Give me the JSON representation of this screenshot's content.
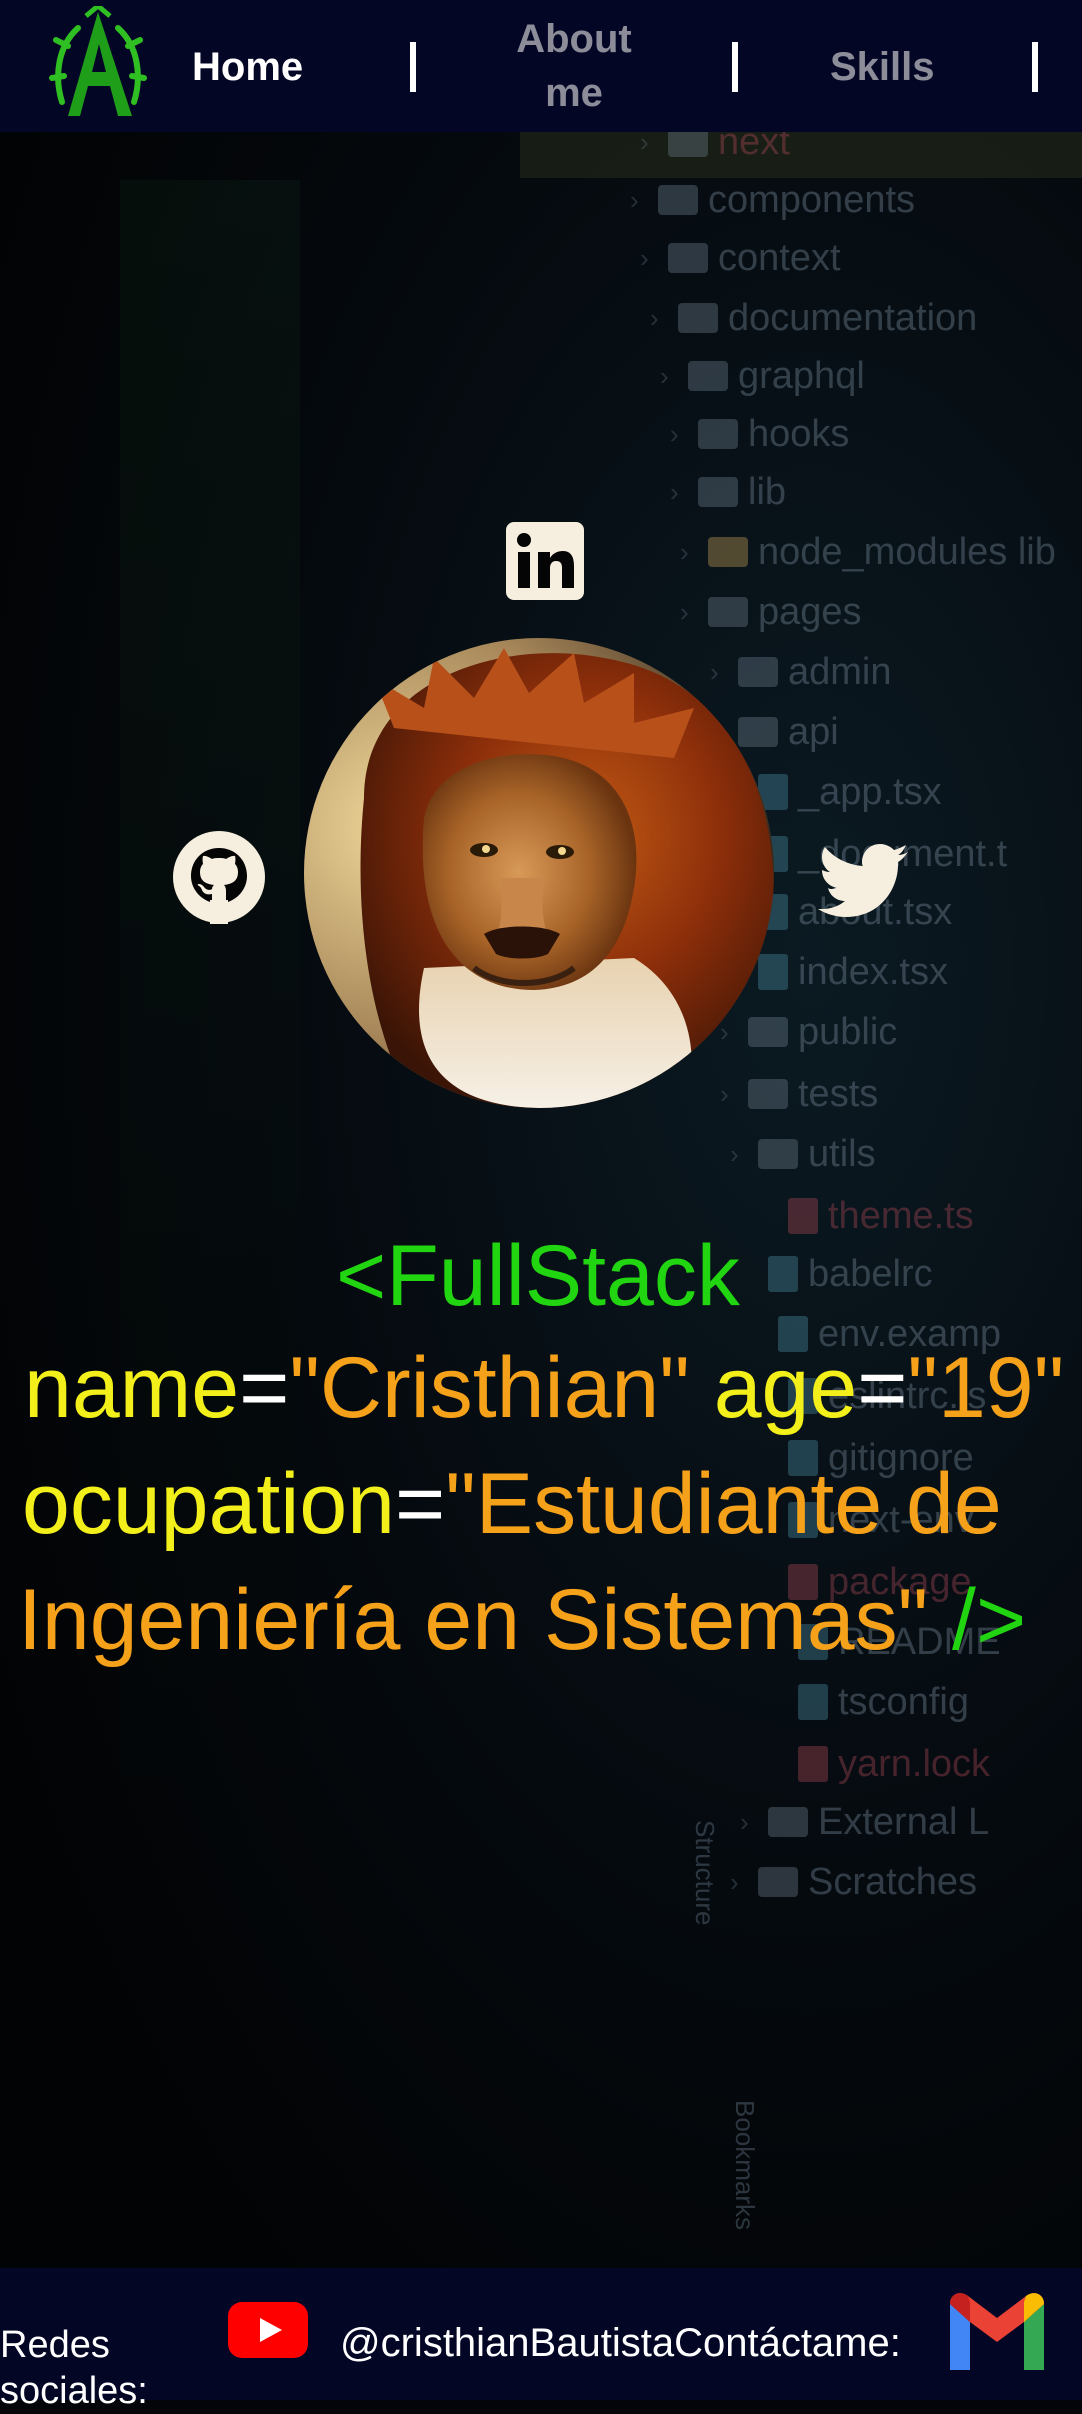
{
  "nav": {
    "home": "Home",
    "about_line1": "About",
    "about_line2": "me",
    "skills": "Skills",
    "separator": "|"
  },
  "hero": {
    "tag_open": "<FullStack",
    "attr_name": "name",
    "val_name": "\"Cristhian\"",
    "attr_age": "age",
    "val_age": "\"19\"",
    "attr_ocupation": "ocupation",
    "val_ocupation_part1": "\"Estudiante de",
    "val_ocupation_part2": "Ingeniería en Sistemas\"",
    "tag_close": "/>",
    "equals": "="
  },
  "background_tree": {
    "items": [
      {
        "label": "next",
        "kind": "folder"
      },
      {
        "label": "components",
        "kind": "folder"
      },
      {
        "label": "context",
        "kind": "folder"
      },
      {
        "label": "documentation",
        "kind": "folder"
      },
      {
        "label": "graphql",
        "kind": "folder"
      },
      {
        "label": "hooks",
        "kind": "folder"
      },
      {
        "label": "lib",
        "kind": "folder"
      },
      {
        "label": "node_modules  lib",
        "kind": "folder"
      },
      {
        "label": "pages",
        "kind": "folder"
      },
      {
        "label": "admin",
        "kind": "folder"
      },
      {
        "label": "api",
        "kind": "folder"
      },
      {
        "label": "_app.tsx",
        "kind": "file"
      },
      {
        "label": "_document.t",
        "kind": "file"
      },
      {
        "label": "about.tsx",
        "kind": "file"
      },
      {
        "label": "index.tsx",
        "kind": "file"
      },
      {
        "label": "public",
        "kind": "folder"
      },
      {
        "label": "tests",
        "kind": "folder"
      },
      {
        "label": "utils",
        "kind": "folder"
      },
      {
        "label": "theme.ts",
        "kind": "file"
      },
      {
        "label": "babelrc",
        "kind": "file"
      },
      {
        "label": "env.examp",
        "kind": "file"
      },
      {
        "label": "eslintrc.js",
        "kind": "file"
      },
      {
        "label": "gitignore",
        "kind": "file"
      },
      {
        "label": "next-env.",
        "kind": "file"
      },
      {
        "label": "package",
        "kind": "file"
      },
      {
        "label": "README",
        "kind": "file"
      },
      {
        "label": "tsconfig",
        "kind": "file"
      },
      {
        "label": "yarn.lock",
        "kind": "file"
      },
      {
        "label": "External L",
        "kind": "folder"
      },
      {
        "label": "Scratches",
        "kind": "folder"
      }
    ],
    "vertical_label_1": "Structure",
    "vertical_label_2": "Bookmarks"
  },
  "footer": {
    "label_line1": "Redes",
    "label_line2": "sociales:",
    "handle": "@cristhianBautistaContáctame:"
  },
  "icons": {
    "logo": "logo-icon",
    "linkedin": "linkedin-icon",
    "github": "github-icon",
    "twitter": "twitter-icon",
    "youtube": "youtube-icon",
    "gmail": "gmail-icon"
  },
  "colors": {
    "header_bg": "#040626",
    "tag_green": "#21d611",
    "attr_yellow": "#f2ef1a",
    "value_orange": "#f5a11a",
    "youtube_red": "#ff0000"
  }
}
